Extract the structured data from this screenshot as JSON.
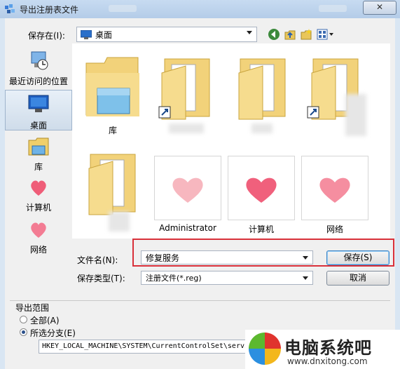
{
  "window": {
    "title": "导出注册表文件",
    "close_label": "✕"
  },
  "location": {
    "label": "保存在(I):",
    "value": "桌面"
  },
  "places": [
    {
      "label": "最近访问的位置"
    },
    {
      "label": "桌面"
    },
    {
      "label": "库"
    },
    {
      "label": "计算机"
    },
    {
      "label": "网络"
    }
  ],
  "files": [
    {
      "label": "库"
    },
    {
      "label": "Administrator"
    },
    {
      "label": "计算机"
    },
    {
      "label": "网络"
    }
  ],
  "filename": {
    "label": "文件名(N):",
    "value": "修复服务"
  },
  "filetype": {
    "label": "保存类型(T):",
    "value": "注册文件(*.reg)"
  },
  "buttons": {
    "save": "保存(S)",
    "cancel": "取消"
  },
  "export_range": {
    "label": "导出范围",
    "options": [
      {
        "label": "全部(A)",
        "selected": false
      },
      {
        "label": "所选分支(E)",
        "selected": true
      }
    ],
    "path": "HKEY_LOCAL_MACHINE\\SYSTEM\\CurrentControlSet\\servi"
  },
  "watermark": {
    "brand": "电脑系统吧",
    "url": "www.dnxitong.com"
  }
}
